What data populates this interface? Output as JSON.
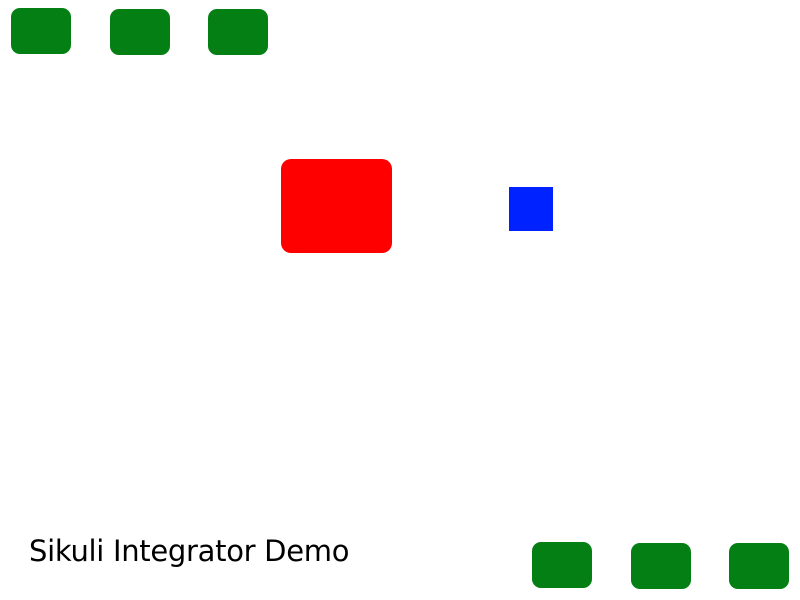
{
  "app": {
    "title": "Sikuli Integrator Demo"
  },
  "colors": {
    "background": "#ffffff",
    "green_button": "#047f13",
    "red_target": "#ff0000",
    "blue_square": "#0022ff",
    "title_text": "#000000"
  },
  "top_buttons": [
    {
      "label": ""
    },
    {
      "label": ""
    },
    {
      "label": ""
    }
  ],
  "bottom_buttons": [
    {
      "label": ""
    },
    {
      "label": ""
    },
    {
      "label": ""
    }
  ]
}
